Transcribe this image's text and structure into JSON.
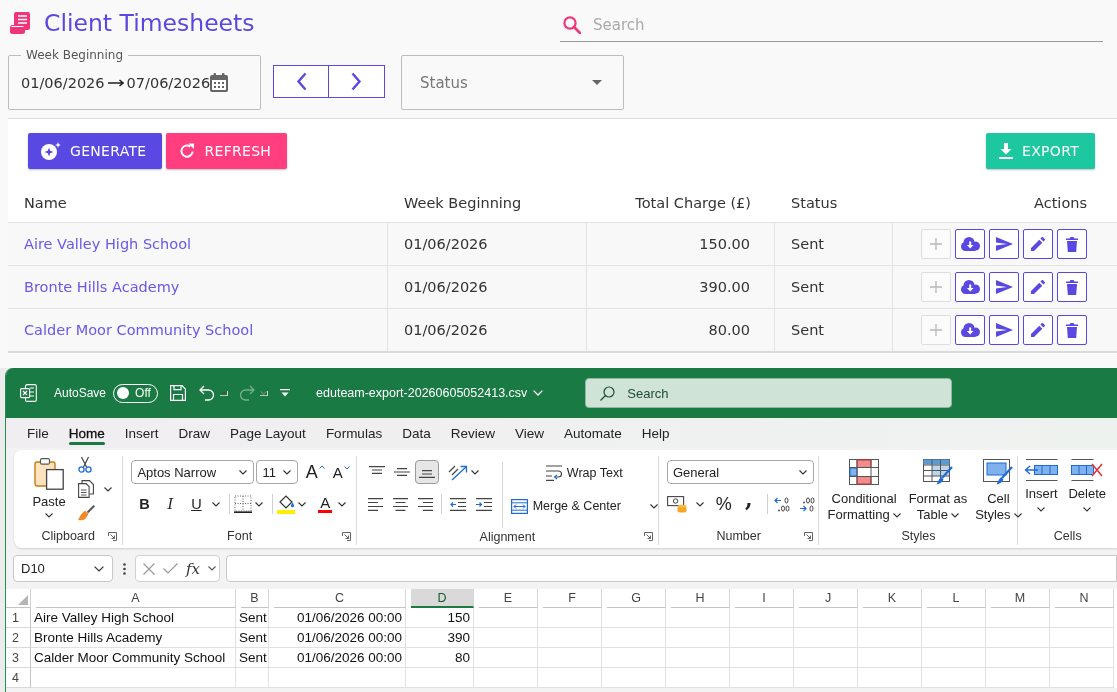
{
  "app": {
    "title": "Client Timesheets",
    "search": {
      "placeholder": "Search"
    },
    "week_filter": {
      "label": "Week Beginning",
      "start": "01/06/2026",
      "end": "07/06/2026"
    },
    "status_filter": {
      "placeholder": "Status"
    },
    "actions": [
      {
        "kind": "generate",
        "label": "GENERATE"
      },
      {
        "kind": "refresh",
        "label": "REFRESH"
      },
      {
        "kind": "export",
        "label": "EXPORT"
      }
    ],
    "table": {
      "columns": [
        "Name",
        "Week Beginning",
        "Total Charge (£)",
        "Status",
        "Actions"
      ],
      "rows": [
        {
          "name": "Aire Valley High School",
          "week_beginning": "01/06/2026",
          "total_charge": "150.00",
          "status": "Sent",
          "expand_disabled": true
        },
        {
          "name": "Bronte Hills Academy",
          "week_beginning": "01/06/2026",
          "total_charge": "390.00",
          "status": "Sent",
          "expand_disabled": true
        },
        {
          "name": "Calder Moor Community School",
          "week_beginning": "01/06/2026",
          "total_charge": "80.00",
          "status": "Sent",
          "expand_disabled": true
        }
      ]
    }
  },
  "excel": {
    "quick_access": {
      "autosave_label": "AutoSave",
      "autosave_state": "Off",
      "autosave_on": false,
      "undo_disabled": false,
      "redo_disabled": true
    },
    "file_name": "eduteam-export-20260605052413.csv",
    "search": {
      "placeholder": "Search"
    },
    "tabs": [
      {
        "label": "File",
        "selected": false
      },
      {
        "label": "Home",
        "selected": true
      },
      {
        "label": "Insert",
        "selected": false
      },
      {
        "label": "Draw",
        "selected": false
      },
      {
        "label": "Page Layout",
        "selected": false
      },
      {
        "label": "Formulas",
        "selected": false
      },
      {
        "label": "Data",
        "selected": false
      },
      {
        "label": "Review",
        "selected": false
      },
      {
        "label": "View",
        "selected": false
      },
      {
        "label": "Automate",
        "selected": false
      },
      {
        "label": "Help",
        "selected": false
      }
    ],
    "ribbon": {
      "groups": [
        {
          "kind": "clipboard",
          "label": "Clipboard",
          "paste_label": "Paste"
        },
        {
          "kind": "font",
          "label": "Font",
          "font_name": "Aptos Narrow",
          "font_size": "11",
          "grow_glyph": "A",
          "shrink_glyph": "A",
          "style_glyphs": [
            "B",
            "I",
            "U"
          ],
          "color_glyph": "A"
        },
        {
          "kind": "alignment",
          "label": "Alignment",
          "vertical_align": [
            {
              "selected": false
            },
            {
              "selected": false
            },
            {
              "selected": true
            }
          ],
          "wrap_label": "Wrap Text",
          "merge_label": "Merge & Center"
        },
        {
          "kind": "number",
          "label": "Number",
          "format": "General",
          "percent_glyph": "%",
          "comma_glyph": ","
        },
        {
          "kind": "styles",
          "label": "Styles",
          "commands": [
            {
              "kind": "conditional",
              "lines": [
                "Conditional",
                "Formatting"
              ]
            },
            {
              "kind": "table",
              "lines": [
                "Format as",
                "Table"
              ]
            },
            {
              "kind": "cell",
              "lines": [
                "Cell",
                "Styles"
              ]
            }
          ]
        },
        {
          "kind": "cells",
          "label": "Cells",
          "commands": [
            {
              "kind": "insert",
              "label": "Insert"
            },
            {
              "kind": "delete",
              "label": "Delete"
            }
          ]
        }
      ]
    },
    "formula_bar": {
      "name_box": "D10",
      "function_label": "fx"
    },
    "sheet": {
      "columns": [
        {
          "label": "A",
          "selected": false
        },
        {
          "label": "B",
          "selected": false
        },
        {
          "label": "C",
          "selected": false
        },
        {
          "label": "D",
          "selected": true
        },
        {
          "label": "E",
          "selected": false
        },
        {
          "label": "F",
          "selected": false
        },
        {
          "label": "G",
          "selected": false
        },
        {
          "label": "H",
          "selected": false
        },
        {
          "label": "I",
          "selected": false
        },
        {
          "label": "J",
          "selected": false
        },
        {
          "label": "K",
          "selected": false
        },
        {
          "label": "L",
          "selected": false
        },
        {
          "label": "M",
          "selected": false
        },
        {
          "label": "N",
          "selected": false
        }
      ],
      "rows": [
        {
          "header": "1",
          "cells": [
            "Aire Valley High School",
            "Sent",
            "01/06/2026 00:00",
            "150"
          ]
        },
        {
          "header": "2",
          "cells": [
            "Bronte Hills Academy",
            "Sent",
            "01/06/2026 00:00",
            "390"
          ]
        },
        {
          "header": "3",
          "cells": [
            "Calder Moor Community School",
            "Sent",
            "01/06/2026 00:00",
            "80"
          ]
        },
        {
          "header": "4"
        }
      ]
    }
  }
}
